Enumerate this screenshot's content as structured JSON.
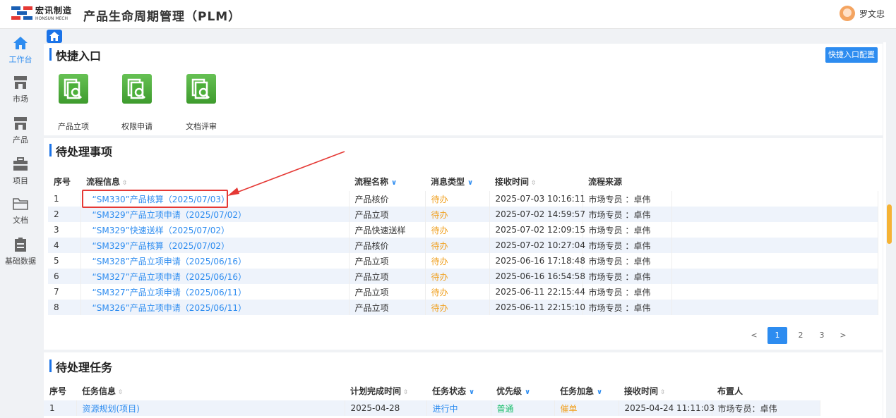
{
  "header": {
    "logo_cn": "宏讯制造",
    "logo_en": "HONSUN MECH",
    "title": "产品生命周期管理（PLM）",
    "user_name": "罗文忠"
  },
  "sidebar": {
    "items": [
      {
        "label": "工作台",
        "icon": "home-icon",
        "active": true
      },
      {
        "label": "市场",
        "icon": "store-icon"
      },
      {
        "label": "产品",
        "icon": "store-icon"
      },
      {
        "label": "项目",
        "icon": "briefcase-icon"
      },
      {
        "label": "文档",
        "icon": "folder-icon"
      },
      {
        "label": "基础数据",
        "icon": "clipboard-icon"
      }
    ]
  },
  "quick_entry": {
    "title": "快捷入口",
    "config_button": "快捷入口配置",
    "items": [
      "产品立项",
      "权限申请",
      "文档评审"
    ]
  },
  "pending_items": {
    "title": "待处理事项",
    "columns": [
      "序号",
      "流程信息",
      "流程名称",
      "消息类型",
      "接收时间",
      "流程来源"
    ],
    "rows": [
      {
        "no": "1",
        "info": "“SM330”产品核算（2025/07/03）",
        "name": "产品核价",
        "type": "待办",
        "time": "2025-07-03 10:16:11",
        "source": "市场专员 ：卓伟"
      },
      {
        "no": "2",
        "info": "“SM329”产品立项申请（2025/07/02）",
        "name": "产品立项",
        "type": "待办",
        "time": "2025-07-02 14:59:57",
        "source": "市场专员 ：卓伟"
      },
      {
        "no": "3",
        "info": "“SM329”快速送样（2025/07/02）",
        "name": "产品快速送样",
        "type": "待办",
        "time": "2025-07-02 12:09:15",
        "source": "市场专员 ：卓伟"
      },
      {
        "no": "4",
        "info": "“SM329”产品核算（2025/07/02）",
        "name": "产品核价",
        "type": "待办",
        "time": "2025-07-02 10:27:04",
        "source": "市场专员 ：卓伟"
      },
      {
        "no": "5",
        "info": "“SM328”产品立项申请（2025/06/16）",
        "name": "产品立项",
        "type": "待办",
        "time": "2025-06-16 17:18:48",
        "source": "市场专员 ：卓伟"
      },
      {
        "no": "6",
        "info": "“SM327”产品立项申请（2025/06/16）",
        "name": "产品立项",
        "type": "待办",
        "time": "2025-06-16 16:54:58",
        "source": "市场专员 ：卓伟"
      },
      {
        "no": "7",
        "info": "“SM327”产品立项申请（2025/06/11）",
        "name": "产品立项",
        "type": "待办",
        "time": "2025-06-11 22:15:44",
        "source": "市场专员 ：卓伟"
      },
      {
        "no": "8",
        "info": "“SM326”产品立项申请（2025/06/11）",
        "name": "产品立项",
        "type": "待办",
        "time": "2025-06-11 22:15:10",
        "source": "市场专员 ：卓伟"
      }
    ],
    "pagination": {
      "prev": "<",
      "pages": [
        "1",
        "2",
        "3"
      ],
      "current": "1",
      "next": ">"
    }
  },
  "pending_tasks": {
    "title": "待处理任务",
    "columns": [
      "序号",
      "任务信息",
      "计划完成时间",
      "任务状态",
      "优先级",
      "任务加急",
      "接收时间",
      "布置人"
    ],
    "rows": [
      {
        "no": "1",
        "info": "资源规划(项目)",
        "plan": "2025-04-28",
        "status": "进行中",
        "priority": "普通",
        "urgent": "催单",
        "time": "2025-04-24 11:11:03",
        "assigner": "市场专员：卓伟"
      }
    ]
  },
  "colors": {
    "accent": "#2d8cf0",
    "annotation": "#e53935",
    "todo": "#f0a020",
    "quick_icon": "#4caf3a"
  }
}
